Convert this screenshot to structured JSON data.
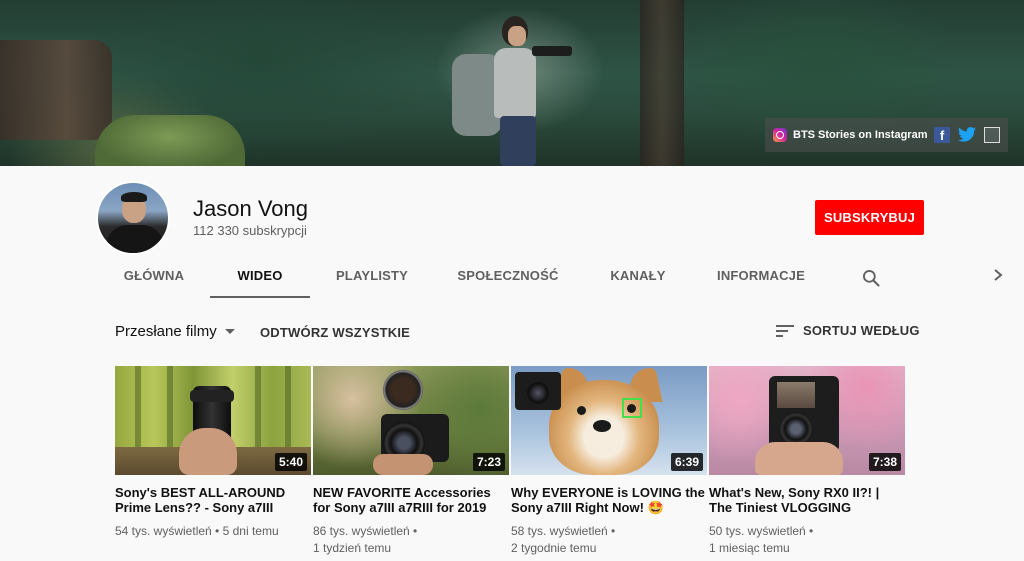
{
  "banner": {
    "social_link_text": "BTS Stories on Instagram",
    "icons": [
      "instagram-icon",
      "facebook-icon",
      "twitter-icon",
      "link-icon"
    ]
  },
  "channel": {
    "name": "Jason Vong",
    "subscribers": "112 330 subskrypcji",
    "subscribe_label": "SUBSKRYBUJ",
    "subscribe_color": "#ff0000"
  },
  "tabs": [
    {
      "label": "GŁÓWNA",
      "active": false
    },
    {
      "label": "WIDEO",
      "active": true
    },
    {
      "label": "PLAYLISTY",
      "active": false
    },
    {
      "label": "SPOŁECZNOŚĆ",
      "active": false
    },
    {
      "label": "KANAŁY",
      "active": false
    },
    {
      "label": "INFORMACJE",
      "active": false
    }
  ],
  "toolbar": {
    "section_title": "Przesłane filmy",
    "play_all": "ODTWÓRZ WSZYSTKIE",
    "sort_label": "SORTUJ WEDŁUG"
  },
  "videos": [
    {
      "duration": "5:40",
      "title": "Sony's BEST ALL-AROUND Prime Lens?? - Sony a7III",
      "views": "54 tys. wyświetleń",
      "separator": "•",
      "age": "5 dni temu"
    },
    {
      "duration": "7:23",
      "title": "NEW FAVORITE Accessories for Sony a7III a7RIII for 2019",
      "views": "86 tys. wyświetleń",
      "separator": "•",
      "age": "1 tydzień temu"
    },
    {
      "duration": "6:39",
      "title": "Why EVERYONE is LOVING the Sony a7III Right Now! 🤩",
      "views": "58 tys. wyświetleń",
      "separator": "•",
      "age": "2 tygodnie temu"
    },
    {
      "duration": "7:38",
      "title": "What's New, Sony RX0 II?! | The Tiniest VLOGGING",
      "views": "50 tys. wyświetleń",
      "separator": "•",
      "age": "1 miesiąc temu"
    }
  ]
}
